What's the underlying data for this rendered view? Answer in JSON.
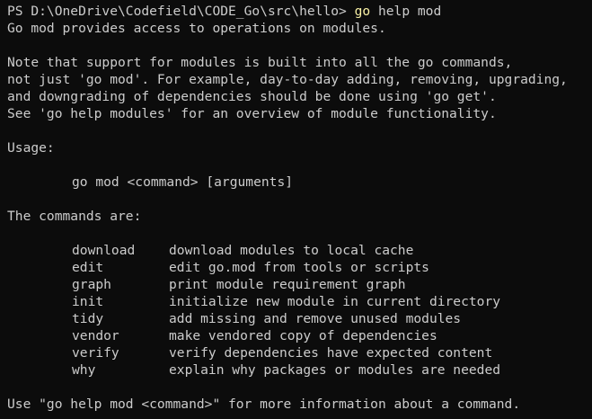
{
  "prompt": {
    "prefix": "PS D:\\OneDrive\\Codefield\\CODE_Go\\src\\hello> ",
    "command": "go",
    "args": " help mod"
  },
  "output": {
    "intro": "Go mod provides access to operations on modules.",
    "note_lines": [
      "Note that support for modules is built into all the go commands,",
      "not just 'go mod'. For example, day-to-day adding, removing, upgrading,",
      "and downgrading of dependencies should be done using 'go get'.",
      "See 'go help modules' for an overview of module functionality."
    ],
    "usage_label": "Usage:",
    "usage_syntax": "go mod <command> [arguments]",
    "commands_label": "The commands are:",
    "commands": [
      {
        "name": "download",
        "desc": "download modules to local cache"
      },
      {
        "name": "edit",
        "desc": "edit go.mod from tools or scripts"
      },
      {
        "name": "graph",
        "desc": "print module requirement graph"
      },
      {
        "name": "init",
        "desc": "initialize new module in current directory"
      },
      {
        "name": "tidy",
        "desc": "add missing and remove unused modules"
      },
      {
        "name": "vendor",
        "desc": "make vendored copy of dependencies"
      },
      {
        "name": "verify",
        "desc": "verify dependencies have expected content"
      },
      {
        "name": "why",
        "desc": "explain why packages or modules are needed"
      }
    ],
    "footer": "Use \"go help mod <command>\" for more information about a command."
  },
  "colors": {
    "background": "#0c0c0c",
    "text": "#cccccc",
    "command_highlight": "#f9f1a5"
  }
}
